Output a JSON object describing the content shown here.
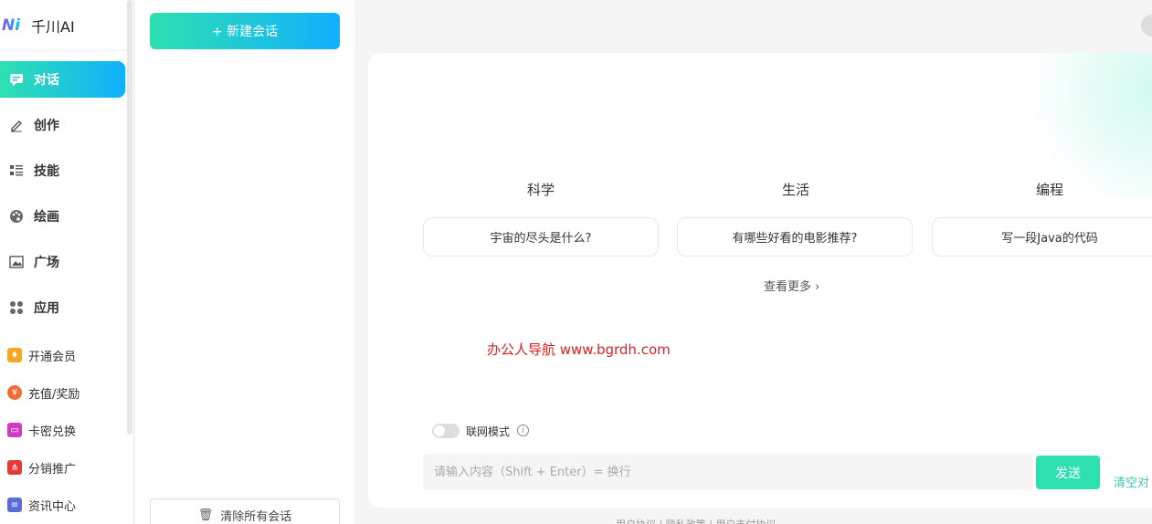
{
  "brand": {
    "name": "千川AI",
    "logo_letters": "Ni"
  },
  "nav": {
    "items": [
      {
        "label": "对话",
        "icon": "chat-icon"
      },
      {
        "label": "创作",
        "icon": "pen-icon"
      },
      {
        "label": "技能",
        "icon": "list-icon"
      },
      {
        "label": "绘画",
        "icon": "palette-icon"
      },
      {
        "label": "广场",
        "icon": "image-icon"
      },
      {
        "label": "应用",
        "icon": "apps-icon"
      }
    ],
    "sub_items": [
      {
        "label": "开通会员",
        "icon": "vip-icon",
        "color": "#f5a623"
      },
      {
        "label": "充值/奖励",
        "icon": "coin-icon",
        "color": "#f06a35"
      },
      {
        "label": "卡密兑换",
        "icon": "card-icon",
        "color": "#d03cbf"
      },
      {
        "label": "分销推广",
        "icon": "network-icon",
        "color": "#e53935"
      },
      {
        "label": "资讯中心",
        "icon": "news-icon",
        "color": "#5a6bd8"
      }
    ]
  },
  "conversations": {
    "new_button": "+ 新建会话",
    "clear_all": "清除所有会话"
  },
  "main": {
    "categories": [
      {
        "title": "科学",
        "question": "宇宙的尽头是什么?"
      },
      {
        "title": "生活",
        "question": "有哪些好看的电影推荐?"
      },
      {
        "title": "编程",
        "question": "写一段Java的代码"
      }
    ],
    "more": "查看更多",
    "watermark": "办公人导航 www.bgrdh.com",
    "network_mode": "联网模式",
    "input_placeholder": "请输入内容（Shift + Enter）= 换行",
    "send": "发送",
    "clear_chat": "清空对",
    "footer": "用户协议 | 隐私政策 | 用户支付协议"
  },
  "colors": {
    "accent_start": "#2ee0b0",
    "accent_end": "#10b0ff",
    "watermark": "#e02020"
  }
}
